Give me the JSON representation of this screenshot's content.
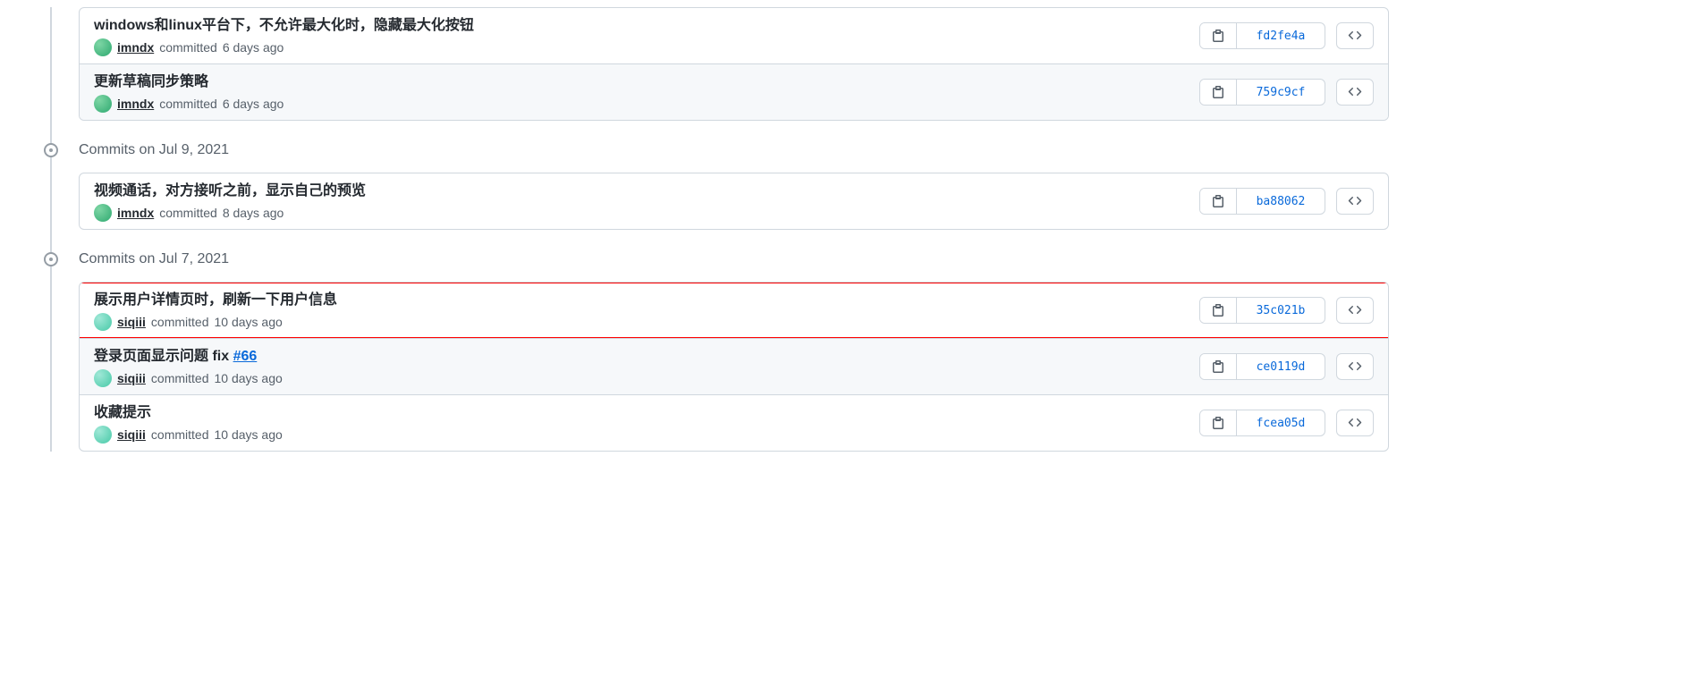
{
  "committed_word": "committed",
  "authors": {
    "imndx": {
      "name": "imndx",
      "avatar_style": "green"
    },
    "siqiii": {
      "name": "siqiii",
      "avatar_style": "teal"
    }
  },
  "groups": [
    {
      "header": null,
      "commits": [
        {
          "title": "windows和linux平台下，不允许最大化时，隐藏最大化按钮",
          "author": "imndx",
          "when": "6 days ago",
          "sha": "fd2fe4a",
          "alt": false,
          "highlighted": false,
          "issue": null
        },
        {
          "title": "更新草稿同步策略",
          "author": "imndx",
          "when": "6 days ago",
          "sha": "759c9cf",
          "alt": true,
          "highlighted": false,
          "issue": null
        }
      ]
    },
    {
      "header": "Commits on Jul 9, 2021",
      "commits": [
        {
          "title": "视频通话，对方接听之前，显示自己的预览",
          "author": "imndx",
          "when": "8 days ago",
          "sha": "ba88062",
          "alt": false,
          "highlighted": false,
          "issue": null
        }
      ]
    },
    {
      "header": "Commits on Jul 7, 2021",
      "commits": [
        {
          "title": "展示用户详情页时，刷新一下用户信息",
          "author": "siqiii",
          "when": "10 days ago",
          "sha": "35c021b",
          "alt": false,
          "highlighted": true,
          "issue": null
        },
        {
          "title": "登录页面显示问题 fix ",
          "author": "siqiii",
          "when": "10 days ago",
          "sha": "ce0119d",
          "alt": true,
          "highlighted": false,
          "issue": "#66"
        },
        {
          "title": "收藏提示",
          "author": "siqiii",
          "when": "10 days ago",
          "sha": "fcea05d",
          "alt": false,
          "highlighted": false,
          "issue": null
        }
      ]
    }
  ]
}
